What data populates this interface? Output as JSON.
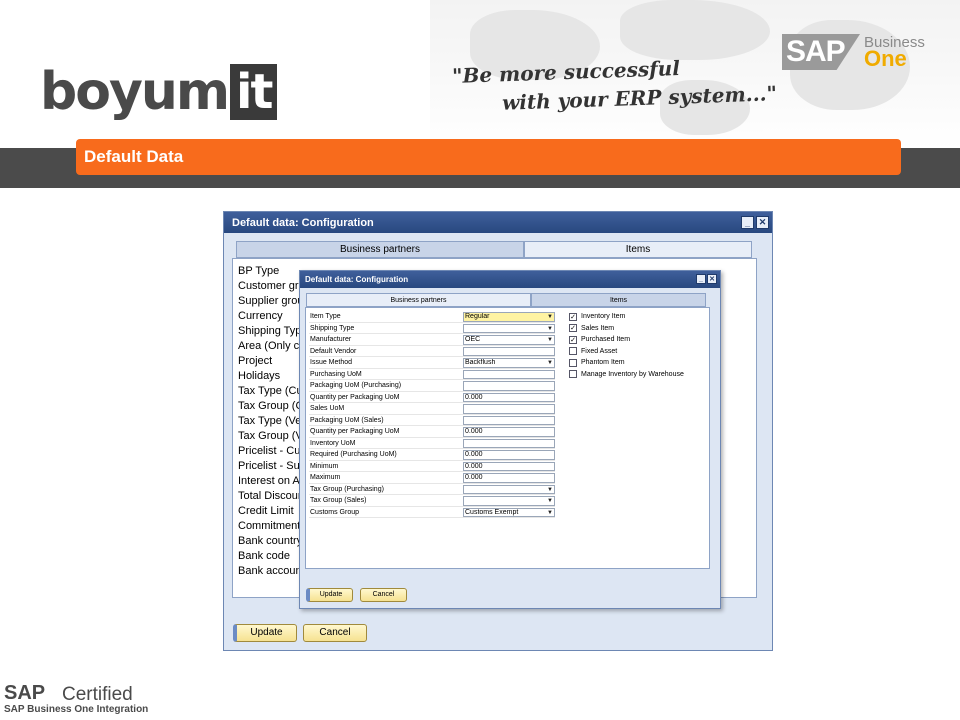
{
  "header": {
    "logo_text": "boyum",
    "logo_box_text": "it",
    "tagline_line1": "\"Be more successful",
    "tagline_line2": "with your ERP system...\"",
    "sap_text": "SAP",
    "sap_business": "Business",
    "sap_one": "One"
  },
  "slide_title": "Default Data",
  "big_window": {
    "title": "Default data: Configuration",
    "tabs": [
      "Business partners",
      "Items"
    ],
    "labels": [
      "BP Type",
      "Customer group",
      "Supplier group",
      "Currency",
      "Shipping Type",
      "Area (Only customer)",
      "Project",
      "Holidays",
      "Tax Type (Customer)",
      "Tax Group (Customer)",
      "Tax Type (Vendor)",
      "Tax Group (Vendor)",
      "Pricelist - Customer",
      "Pricelist - Supplier",
      "Interest on Arrears",
      "Total Discount",
      "Credit Limit",
      "Commitment Limit",
      "Bank country",
      "Bank code",
      "Bank account"
    ],
    "update_label": "Update",
    "cancel_label": "Cancel"
  },
  "small_window": {
    "title": "Default data: Configuration",
    "tabs": [
      "Business partners",
      "Items"
    ],
    "rows": [
      {
        "label": "Item Type",
        "value": "Regular",
        "dropdown": true,
        "highlight": true
      },
      {
        "label": "Shipping Type",
        "value": "",
        "dropdown": true
      },
      {
        "label": "Manufacturer",
        "value": "OEC",
        "dropdown": true
      },
      {
        "label": "Default Vendor",
        "value": ""
      },
      {
        "label": "Issue Method",
        "value": "Backflush",
        "dropdown": true
      },
      {
        "label": "Purchasing UoM",
        "value": ""
      },
      {
        "label": "Packaging UoM (Purchasing)",
        "value": ""
      },
      {
        "label": "Quantity per Packaging UoM",
        "value": "0.000"
      },
      {
        "label": "Sales UoM",
        "value": ""
      },
      {
        "label": "Packaging UoM (Sales)",
        "value": ""
      },
      {
        "label": "Quantity per Packaging UoM",
        "value": "0.000"
      },
      {
        "label": "Inventory UoM",
        "value": ""
      },
      {
        "label": "Required (Purchasing UoM)",
        "value": "0.000"
      },
      {
        "label": "Minimum",
        "value": "0.000"
      },
      {
        "label": "Maximum",
        "value": "0.000"
      },
      {
        "label": "Tax Group (Purchasing)",
        "value": "",
        "dropdown": true
      },
      {
        "label": "Tax Group (Sales)",
        "value": "",
        "dropdown": true
      },
      {
        "label": "Customs Group",
        "value": "Customs Exempt",
        "dropdown": true
      }
    ],
    "checkboxes": [
      {
        "label": "Inventory Item",
        "checked": true
      },
      {
        "label": "Sales Item",
        "checked": true
      },
      {
        "label": "Purchased Item",
        "checked": true
      },
      {
        "label": "Fixed Asset",
        "checked": false
      },
      {
        "label": "Phantom Item",
        "checked": false
      },
      {
        "label": "Manage Inventory by Warehouse",
        "checked": false
      }
    ],
    "update_label": "Update",
    "cancel_label": "Cancel"
  },
  "footer": {
    "sap": "SAP",
    "certified": "Certified",
    "integration": "SAP Business One Integration"
  },
  "colors": {
    "orange": "#f86b1c",
    "band": "#4b4b4b",
    "title_blue": "#28487f"
  }
}
